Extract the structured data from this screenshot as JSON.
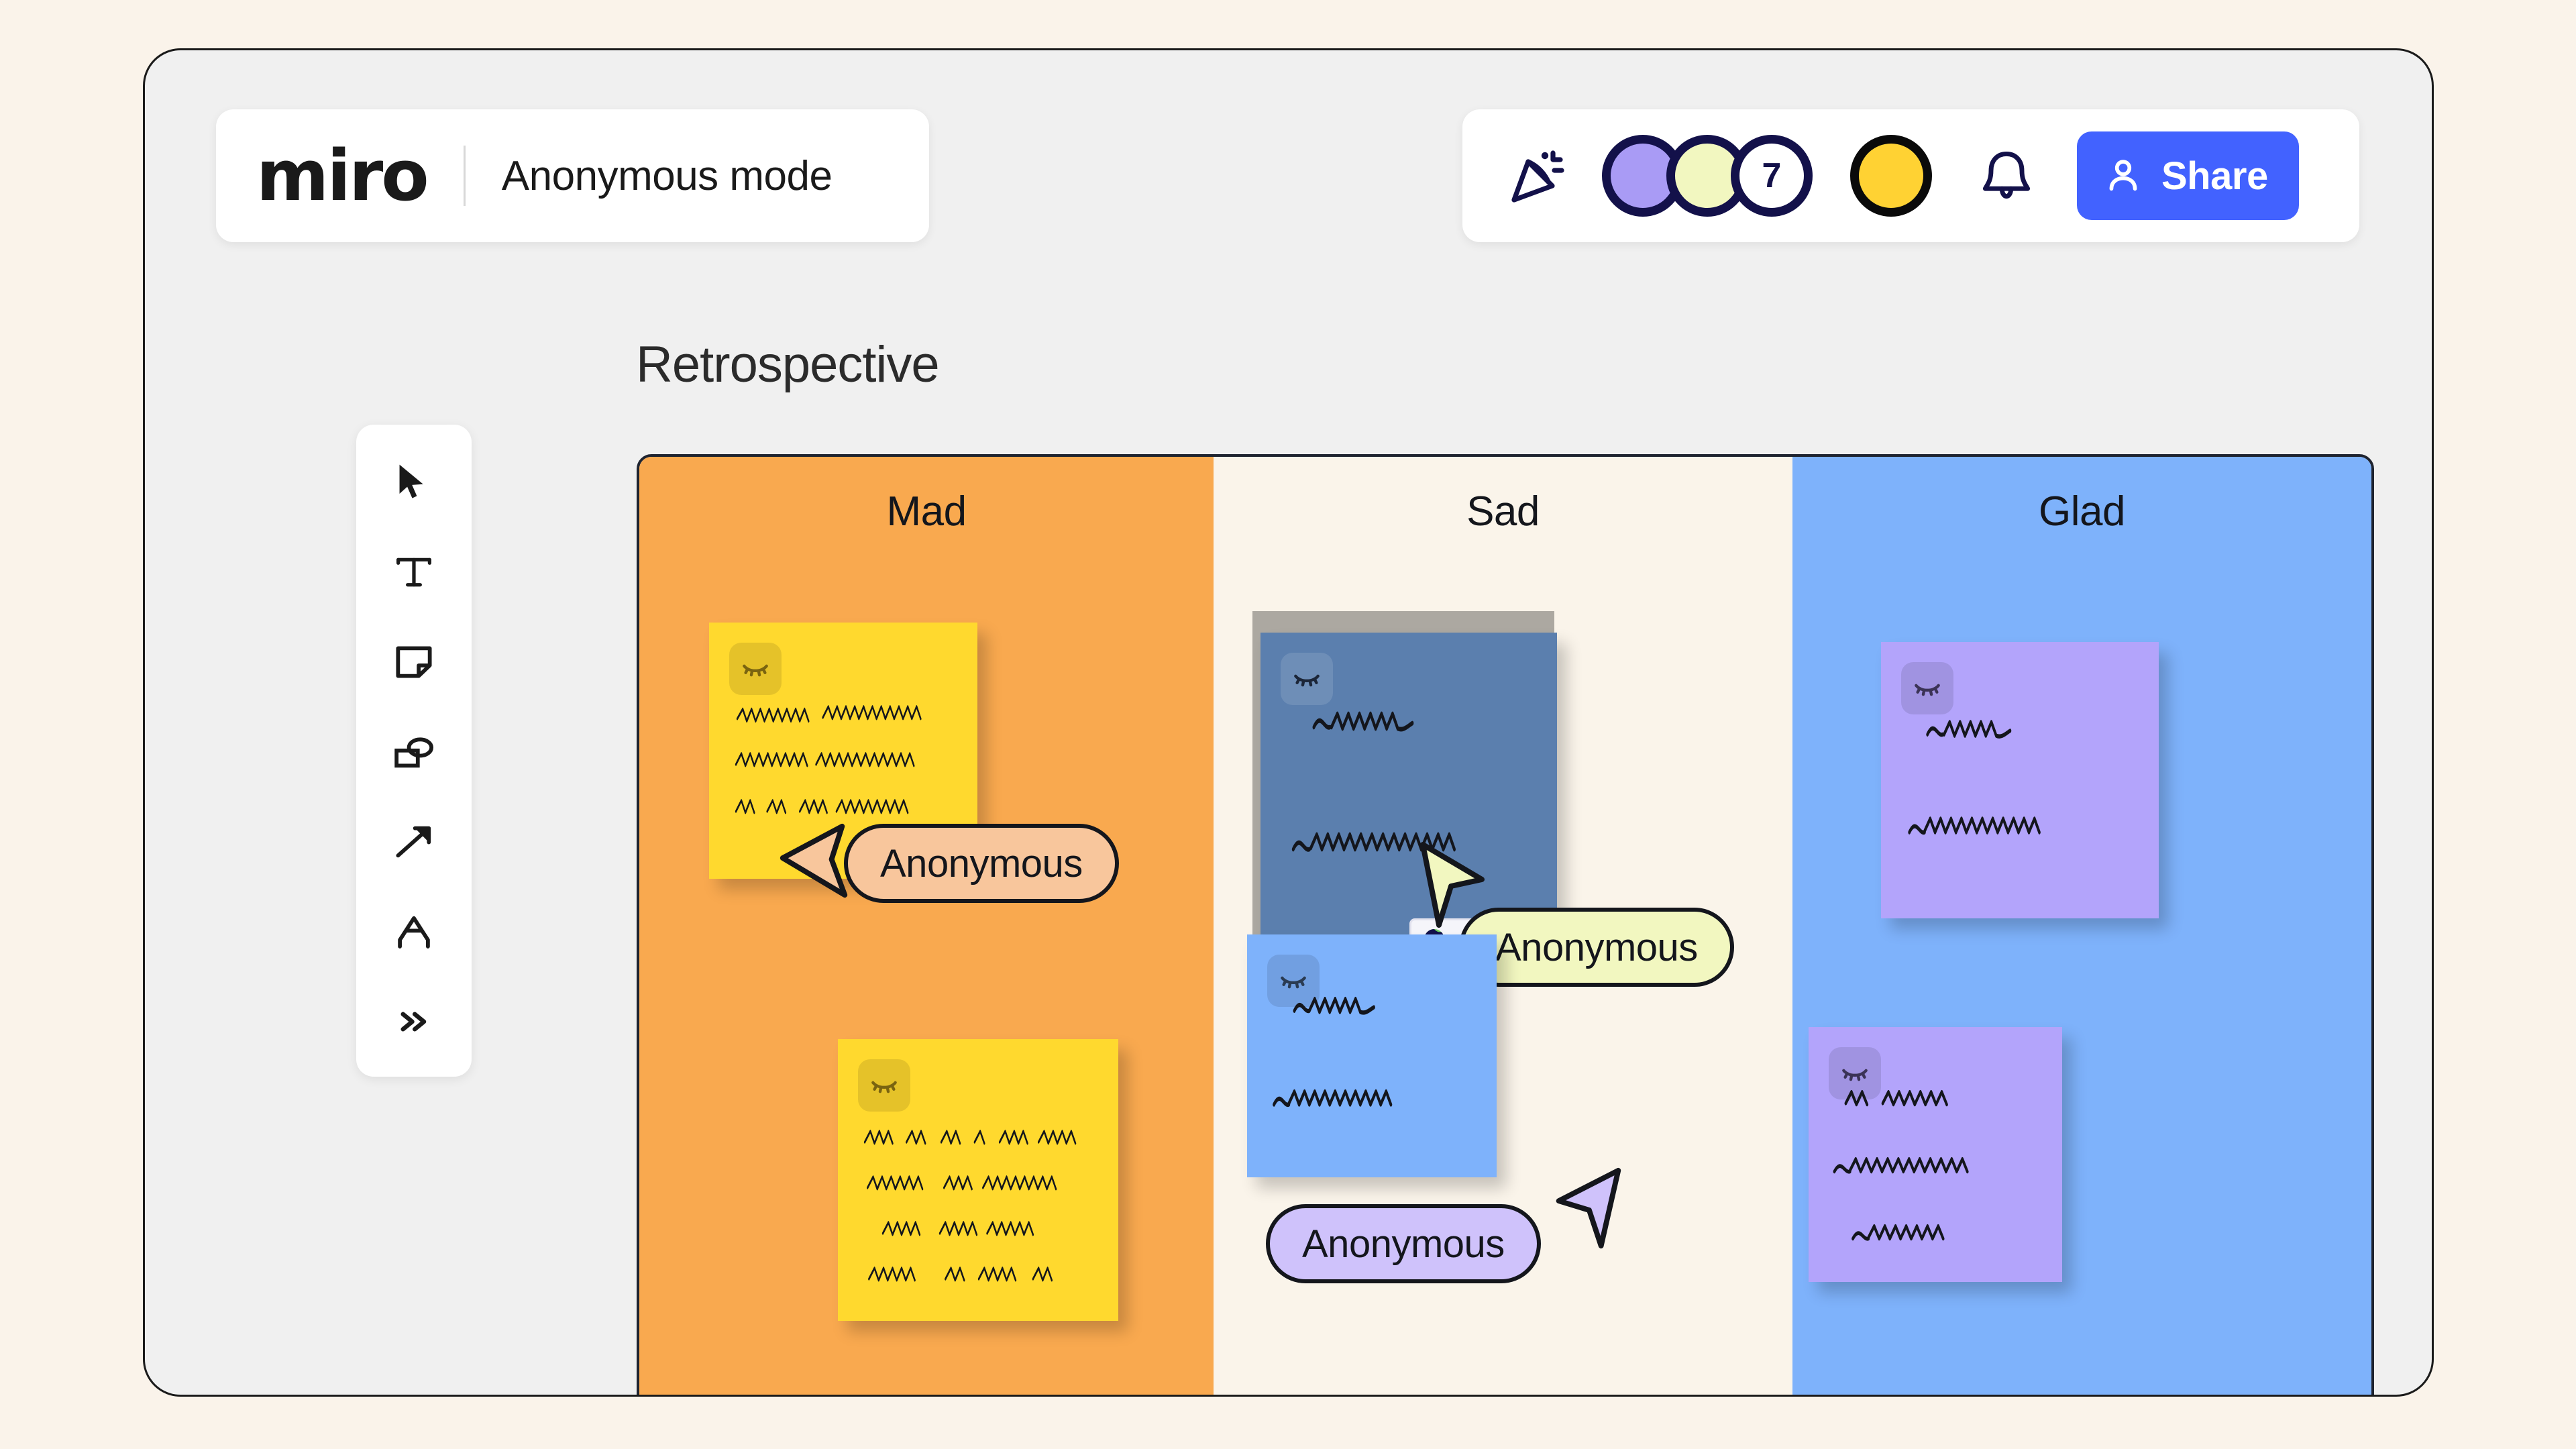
{
  "app": {
    "brand_name": "miro",
    "mode_label": "Anonymous mode"
  },
  "header": {
    "celebrate_icon": "party-popper-icon",
    "bell_icon": "bell-icon",
    "share_label": "Share",
    "share_icon": "person-icon",
    "share_color": "#4262ff",
    "avatars": [
      {
        "name": "avatar-1",
        "color": "#a99bf5",
        "label": ""
      },
      {
        "name": "avatar-2",
        "color": "#f2f7c0",
        "label": ""
      },
      {
        "name": "avatar-overflow",
        "color": "#ffffff",
        "label": "7"
      }
    ],
    "self_avatar": {
      "name": "avatar-self",
      "color": "#ffd233"
    }
  },
  "toolbar": {
    "items": [
      {
        "name": "select-tool",
        "icon": "cursor-arrow-icon",
        "label": "Select"
      },
      {
        "name": "text-tool",
        "icon": "text-icon",
        "label": "Text"
      },
      {
        "name": "sticky-note-tool",
        "icon": "sticky-note-icon",
        "label": "Sticky note"
      },
      {
        "name": "shapes-tool",
        "icon": "shapes-icon",
        "label": "Shapes"
      },
      {
        "name": "connector-tool",
        "icon": "arrow-icon",
        "label": "Connection line"
      },
      {
        "name": "pen-tool",
        "icon": "pen-icon",
        "label": "Pen"
      },
      {
        "name": "more-tools",
        "icon": "chevron-double-right-icon",
        "label": "More tools"
      }
    ]
  },
  "board": {
    "frame_title": "Retrospective",
    "columns": [
      {
        "title": "Mad",
        "bg": "#f9a94f"
      },
      {
        "title": "Sad",
        "bg": "#faf4ea"
      },
      {
        "title": "Glad",
        "bg": "#7eb2fb"
      }
    ],
    "notes": [
      {
        "name": "note-mad-1",
        "column": "Mad",
        "color": "#ffd92e",
        "badge_icon": "closed-eye-icon",
        "lines": 3,
        "hidden_text": true
      },
      {
        "name": "note-mad-2",
        "column": "Mad",
        "color": "#ffd92e",
        "badge_icon": "closed-eye-icon",
        "lines": 4,
        "hidden_text": true
      },
      {
        "name": "note-sad-1",
        "column": "Sad",
        "color": "#7eb2fb",
        "badge_icon": "closed-eye-icon",
        "lines": 2,
        "hidden_text": true,
        "selected": true
      },
      {
        "name": "note-sad-2",
        "column": "Sad",
        "color": "#7eb2fb",
        "badge_icon": "closed-eye-icon",
        "lines": 2,
        "hidden_text": true
      },
      {
        "name": "note-glad-1",
        "column": "Glad",
        "color": "#b3a4fb",
        "badge_icon": "closed-eye-icon",
        "lines": 2,
        "hidden_text": true
      },
      {
        "name": "note-glad-2",
        "column": "Glad",
        "color": "#b3a4fb",
        "badge_icon": "closed-eye-icon",
        "lines": 3,
        "hidden_text": true
      }
    ],
    "cursors": [
      {
        "name": "cursor-anonymous-1",
        "label": "Anonymous",
        "color": "#f8c69c",
        "direction": "left"
      },
      {
        "name": "cursor-anonymous-2",
        "label": "Anonymous",
        "color": "#f2f7c0",
        "direction": "down-right"
      },
      {
        "name": "cursor-anonymous-3",
        "label": "Anonymous",
        "color": "#cfc2fb",
        "direction": "up-right"
      }
    ]
  }
}
